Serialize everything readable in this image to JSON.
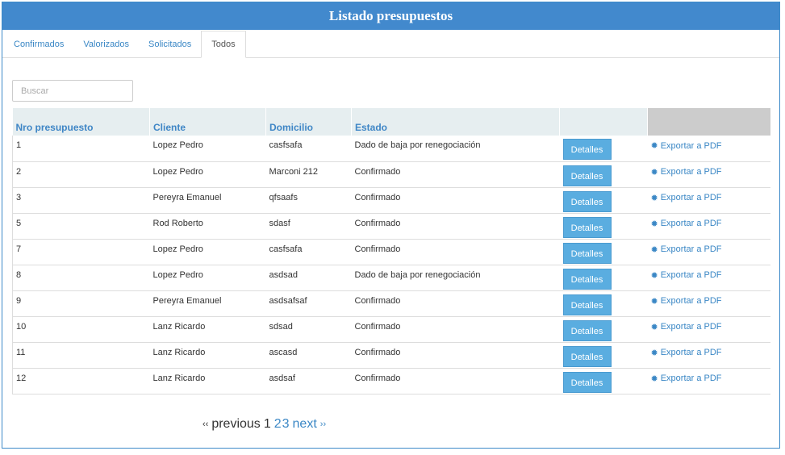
{
  "header": {
    "title": "Listado presupuestos"
  },
  "tabs": [
    {
      "label": "Confirmados"
    },
    {
      "label": "Valorizados"
    },
    {
      "label": "Solicitados"
    },
    {
      "label": "Todos"
    }
  ],
  "search": {
    "placeholder": "Buscar"
  },
  "table": {
    "columns": [
      "Nro presupuesto",
      "Cliente",
      "Domicilio",
      "Estado"
    ],
    "details_label": "Detalles",
    "pdf_label": "Exportar a PDF",
    "rows": [
      {
        "nro": "1",
        "cliente": "Lopez Pedro",
        "domicilio": "casfsafa",
        "estado": "Dado de baja por renegociación"
      },
      {
        "nro": "2",
        "cliente": "Lopez Pedro",
        "domicilio": "Marconi 212",
        "estado": "Confirmado"
      },
      {
        "nro": "3",
        "cliente": "Pereyra Emanuel",
        "domicilio": "qfsaafs",
        "estado": "Confirmado"
      },
      {
        "nro": "5",
        "cliente": "Rod Roberto",
        "domicilio": "sdasf",
        "estado": "Confirmado"
      },
      {
        "nro": "7",
        "cliente": "Lopez Pedro",
        "domicilio": "casfsafa",
        "estado": "Confirmado"
      },
      {
        "nro": "8",
        "cliente": "Lopez Pedro",
        "domicilio": "asdsad",
        "estado": "Dado de baja por renegociación"
      },
      {
        "nro": "9",
        "cliente": "Pereyra Emanuel",
        "domicilio": "asdsafsaf",
        "estado": "Confirmado"
      },
      {
        "nro": "10",
        "cliente": "Lanz Ricardo",
        "domicilio": "sdsad",
        "estado": "Confirmado"
      },
      {
        "nro": "11",
        "cliente": "Lanz Ricardo",
        "domicilio": "ascasd",
        "estado": "Confirmado"
      },
      {
        "nro": "12",
        "cliente": "Lanz Ricardo",
        "domicilio": "asdsaf",
        "estado": "Confirmado"
      }
    ]
  },
  "pagination": {
    "prev_arrow": "‹‹",
    "previous": "previous",
    "pages": [
      "1",
      "2",
      "3"
    ],
    "next": "next",
    "next_arrow": "››"
  }
}
